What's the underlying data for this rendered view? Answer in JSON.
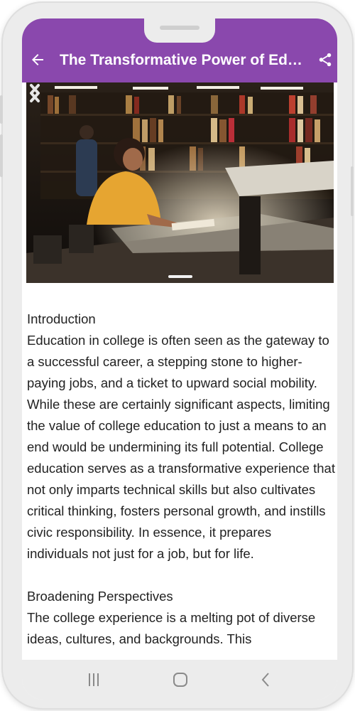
{
  "app_bar": {
    "title": "The Transformative Power of Education in College",
    "back_icon": "arrow-left-icon",
    "share_icon": "share-icon",
    "color": "#8a48ad"
  },
  "carousel": {
    "image_description_icon": "student-studying-in-library-photo",
    "prev_icon": "chevron-left-icon",
    "next_icon": "chevron-right-icon",
    "slide_count": 1,
    "active_slide": 1
  },
  "article": {
    "sections": [
      {
        "heading": "Introduction",
        "body": "Education in college is often seen as the gateway to a successful career, a stepping stone to higher-paying jobs, and a ticket to upward social mobility. While these are certainly significant aspects, limiting the value of college education to just a means to an end would be undermining its full potential. College education serves as a transformative experience that not only imparts technical skills but also cultivates critical thinking, fosters personal growth, and instills civic responsibility. In essence, it prepares individuals not just for a job, but for life."
      },
      {
        "heading": "Broadening Perspectives",
        "body": "The college experience is a melting pot of diverse ideas, cultures, and backgrounds. This"
      }
    ]
  },
  "nav_bar": {
    "recents_icon": "recent-apps-icon",
    "home_icon": "home-icon",
    "back_icon": "back-icon"
  }
}
